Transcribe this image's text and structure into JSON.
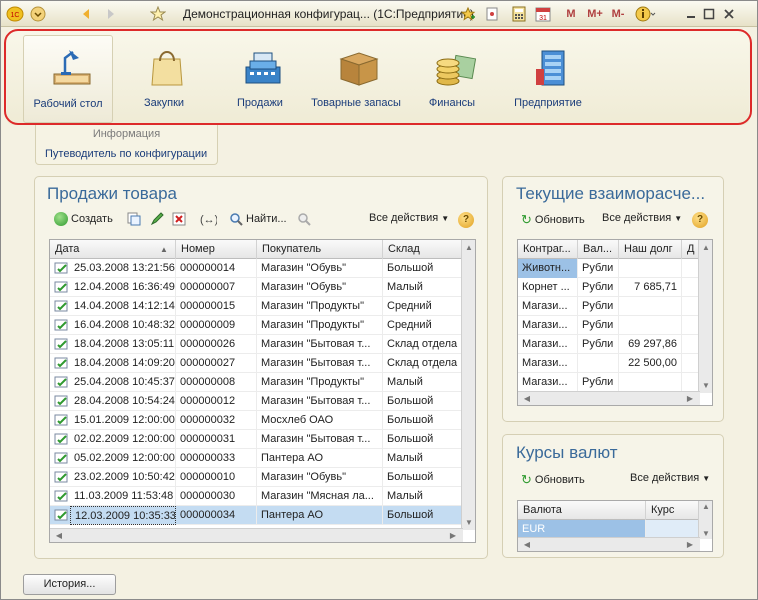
{
  "window": {
    "title": "Демонстрационная конфигурац... (1С:Предприятие)",
    "app_badge": "1С",
    "mem_labels": [
      "M",
      "M+",
      "M-"
    ],
    "calendar_day": "31"
  },
  "sections": [
    {
      "label": "Рабочий стол",
      "icon": "desk-lamp-icon",
      "active": true
    },
    {
      "label": "Закупки",
      "icon": "shopping-bag-icon",
      "active": false
    },
    {
      "label": "Продажи",
      "icon": "cash-register-icon",
      "active": false
    },
    {
      "label": "Товарные запасы",
      "icon": "box-icon",
      "active": false
    },
    {
      "label": "Финансы",
      "icon": "coins-icon",
      "active": false
    },
    {
      "label": "Предприятие",
      "icon": "building-icon",
      "active": false
    }
  ],
  "nav": {
    "info": "Информация",
    "guide": "Путеводитель по конфигурации"
  },
  "sales": {
    "title": "Продажи товара",
    "toolbar": {
      "create": "Создать",
      "find": "Найти...",
      "all_actions": "Все действия",
      "help": "?"
    },
    "columns": [
      "Дата",
      "Номер",
      "Покупатель",
      "Склад"
    ],
    "rows": [
      [
        "25.03.2008 13:21:56",
        "000000014",
        "Магазин \"Обувь\"",
        "Большой"
      ],
      [
        "12.04.2008 16:36:49",
        "000000007",
        "Магазин \"Обувь\"",
        "Малый"
      ],
      [
        "14.04.2008 14:12:14",
        "000000015",
        "Магазин \"Продукты\"",
        "Средний"
      ],
      [
        "16.04.2008 10:48:32",
        "000000009",
        "Магазин \"Продукты\"",
        "Средний"
      ],
      [
        "18.04.2008 13:05:11",
        "000000026",
        "Магазин \"Бытовая т...",
        "Склад отдела"
      ],
      [
        "18.04.2008 14:09:20",
        "000000027",
        "Магазин \"Бытовая т...",
        "Склад отдела"
      ],
      [
        "25.04.2008 10:45:37",
        "000000008",
        "Магазин \"Продукты\"",
        "Малый"
      ],
      [
        "28.04.2008 10:54:24",
        "000000012",
        "Магазин \"Бытовая т...",
        "Большой"
      ],
      [
        "15.01.2009 12:00:00",
        "000000032",
        "Мосхлеб ОАО",
        "Большой"
      ],
      [
        "02.02.2009 12:00:00",
        "000000031",
        "Магазин \"Бытовая т...",
        "Большой"
      ],
      [
        "05.02.2009 12:00:00",
        "000000033",
        "Пантера АО",
        "Малый"
      ],
      [
        "23.02.2009 10:50:42",
        "000000010",
        "Магазин \"Обувь\"",
        "Большой"
      ],
      [
        "11.03.2009 11:53:48",
        "000000030",
        "Магазин \"Мясная ла...",
        "Малый"
      ],
      [
        "12.03.2009 10:35:33",
        "000000034",
        "Пантера АО",
        "Большой"
      ]
    ],
    "selected_row": 13
  },
  "settlements": {
    "title": "Текущие взаиморасче...",
    "toolbar": {
      "refresh": "Обновить",
      "all_actions": "Все действия",
      "help": "?"
    },
    "columns": [
      "Контраг...",
      "Вал...",
      "Наш долг",
      "Д"
    ],
    "rows": [
      [
        "Животн...",
        "Рубли",
        "",
        ""
      ],
      [
        "Корнет ...",
        "Рубли",
        "7 685,71",
        ""
      ],
      [
        "Магази...",
        "Рубли",
        "",
        ""
      ],
      [
        "Магази...",
        "Рубли",
        "",
        ""
      ],
      [
        "Магази...",
        "Рубли",
        "69 297,86",
        ""
      ],
      [
        "Магази...",
        "",
        "22 500,00",
        ""
      ],
      [
        "Магази...",
        "Рубли",
        "",
        ""
      ]
    ]
  },
  "currency": {
    "title": "Курсы валют",
    "toolbar": {
      "refresh": "Обновить",
      "all_actions": "Все действия"
    },
    "columns": [
      "Валюта",
      "Курс"
    ],
    "rows": [
      [
        "EUR",
        ""
      ]
    ]
  },
  "footer": {
    "history": "История..."
  }
}
